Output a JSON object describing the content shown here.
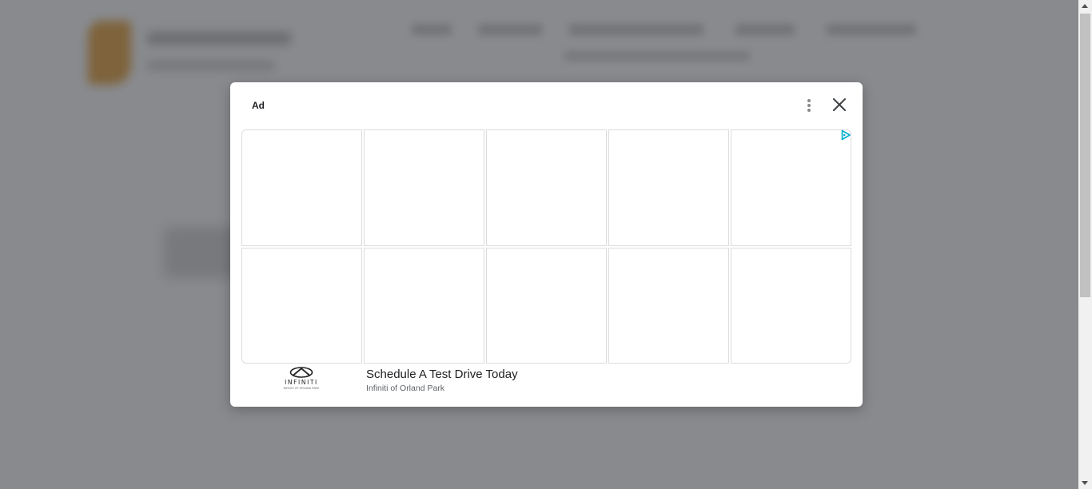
{
  "ad_dialog": {
    "label": "Ad",
    "headline": "Schedule A Test Drive Today",
    "advertiser": "Infiniti of Orland Park",
    "brand_logo": {
      "wordmark": "INFINITI",
      "tagline": "INFINITI OF ORLAND PARK"
    },
    "grid": {
      "rows": 2,
      "columns": 5
    },
    "colors": {
      "overlay": "#5a5e64",
      "adchoices": "#00aecd",
      "close": "#3c4043"
    }
  },
  "icons": {
    "menu": "more-vertical-icon",
    "close": "close-icon",
    "adchoices": "adchoices-icon"
  }
}
